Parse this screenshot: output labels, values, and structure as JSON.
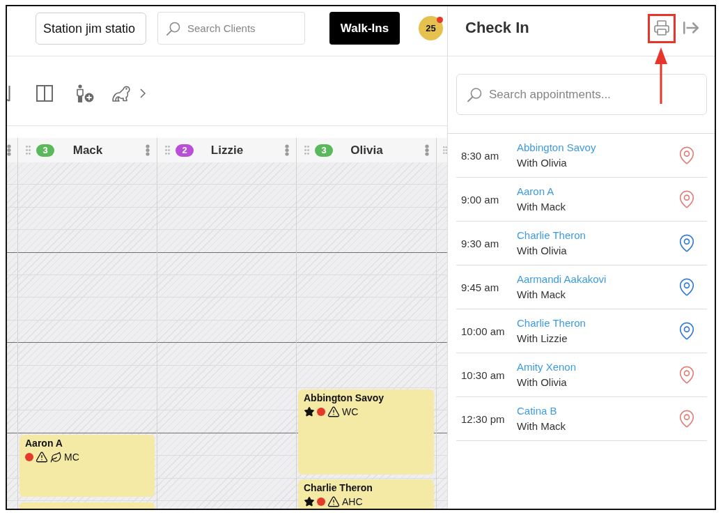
{
  "top_bar": {
    "station_select": {
      "value": "Station jim statio"
    },
    "client_search": {
      "placeholder": "Search Clients"
    },
    "walk_ins_button": {
      "label": "Walk-Ins"
    },
    "notifications": {
      "count": "25",
      "unread": true
    }
  },
  "calendar": {
    "columns": [
      {
        "name": "Mack",
        "count": "3",
        "color": "#5cb85c",
        "events": [
          {
            "name": "Aaron A",
            "markers": [
              {
                "kind": "dot"
              },
              {
                "kind": "warning"
              },
              {
                "kind": "leaf"
              }
            ],
            "code": "MC"
          }
        ]
      },
      {
        "name": "Lizzie",
        "count": "2",
        "color": "#b94fd8"
      },
      {
        "name": "Olivia",
        "count": "3",
        "color": "#5cb85c",
        "events": [
          {
            "name": "Abbington Savoy",
            "markers": [
              {
                "kind": "star"
              },
              {
                "kind": "dot"
              },
              {
                "kind": "warning"
              }
            ],
            "code": "WC"
          },
          {
            "name": "Charlie Theron",
            "markers": [
              {
                "kind": "star"
              },
              {
                "kind": "dot"
              },
              {
                "kind": "warning"
              }
            ],
            "code": "AHC"
          }
        ]
      }
    ]
  },
  "check_in": {
    "title": "Check In",
    "search": {
      "placeholder": "Search appointments..."
    },
    "appointments": [
      {
        "time": "8:30 am",
        "client": "Abbington Savoy",
        "staff": "With Olivia",
        "color": "#e07c76"
      },
      {
        "time": "9:00 am",
        "client": "Aaron A",
        "staff": "With Mack",
        "color": "#e07c76"
      },
      {
        "time": "9:30 am",
        "client": "Charlie Theron",
        "staff": "With Olivia",
        "color": "#2f78d6"
      },
      {
        "time": "9:45 am",
        "client": "Aarmandi Aakakovi",
        "staff": "With Mack",
        "color": "#2f78d6"
      },
      {
        "time": "10:00 am",
        "client": "Charlie Theron",
        "staff": "With Lizzie",
        "color": "#2f78d6"
      },
      {
        "time": "10:30 am",
        "client": "Amity Xenon",
        "staff": "With Olivia",
        "color": "#e07c76"
      },
      {
        "time": "12:30 pm",
        "client": "Catina B",
        "staff": "With Mack",
        "color": "#e07c76"
      }
    ]
  }
}
